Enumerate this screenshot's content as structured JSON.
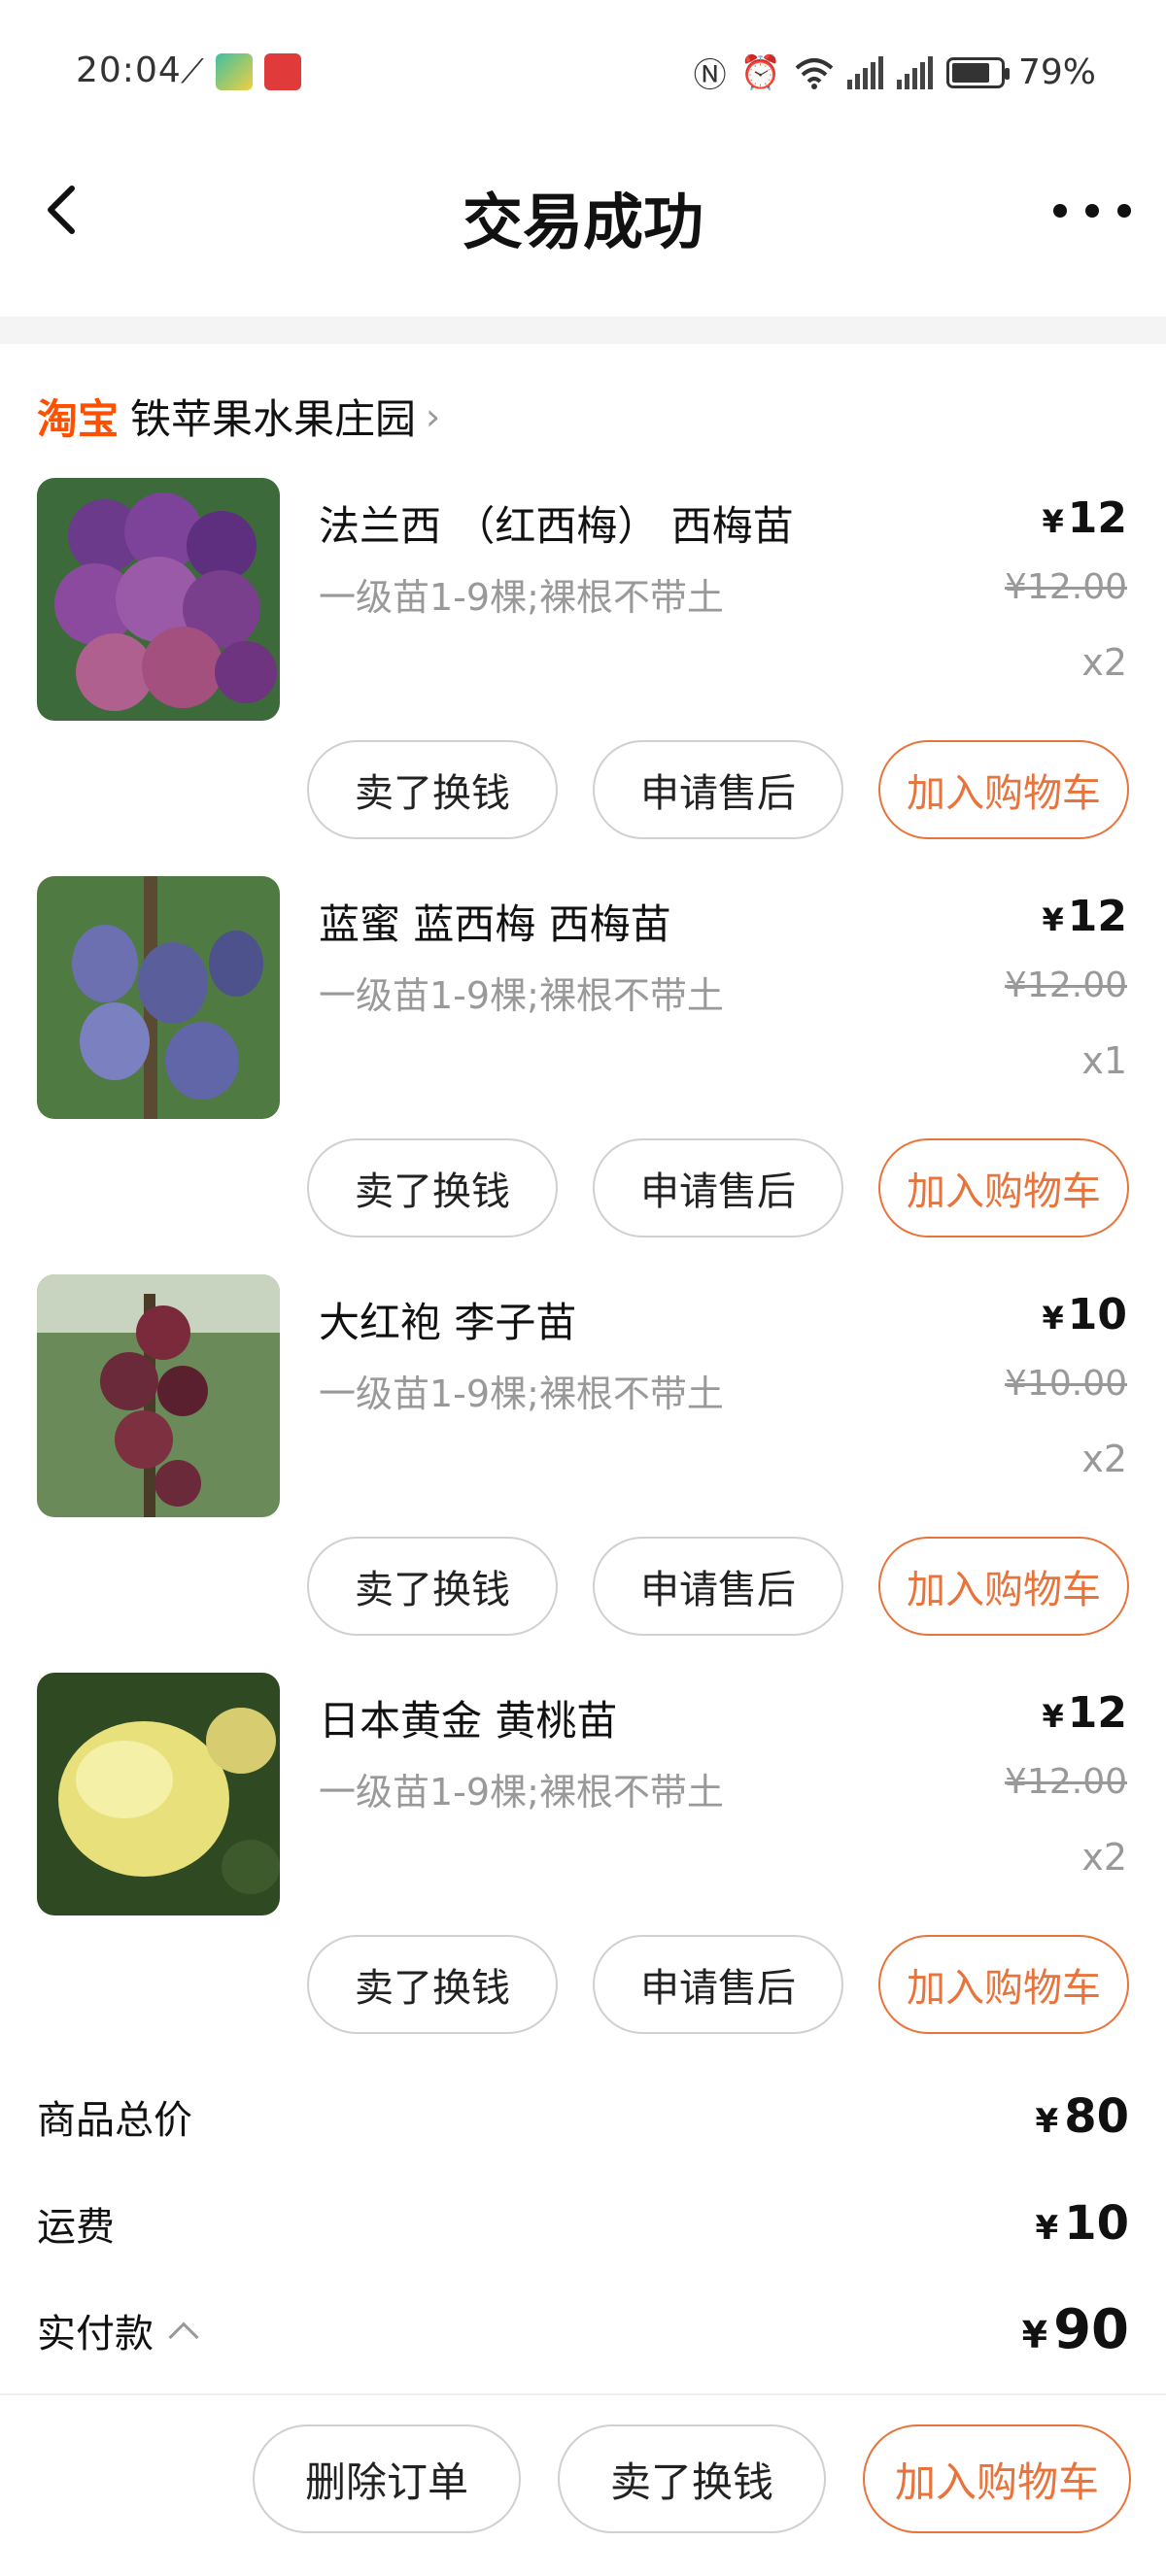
{
  "status_bar": {
    "time": "20:04",
    "battery": "79%",
    "battery_level": 0.79,
    "icons": [
      "link-icon",
      "app-icon-green",
      "app-icon-red",
      "nfc-icon",
      "alarm-icon",
      "wifi-icon",
      "signal-4g-icon",
      "signal-5g-icon"
    ]
  },
  "header": {
    "title": "交易成功"
  },
  "shop": {
    "brand": "淘宝",
    "name": "铁苹果水果庄园",
    "chevron": "›"
  },
  "items": [
    {
      "title": "法兰西 （红西梅） 西梅苗",
      "spec": "一级苗1-9棵;裸根不带土",
      "price": "12",
      "original_price": "¥12.00",
      "qty": "x2",
      "thumb_color": "#7a3f8c",
      "btn_sell": "卖了换钱",
      "btn_after_sale": "申请售后",
      "btn_add_cart": "加入购物车"
    },
    {
      "title": "蓝蜜 蓝西梅 西梅苗",
      "spec": "一级苗1-9棵;裸根不带土",
      "price": "12",
      "original_price": "¥12.00",
      "qty": "x1",
      "thumb_color": "#5a5f9c",
      "btn_sell": "卖了换钱",
      "btn_after_sale": "申请售后",
      "btn_add_cart": "加入购物车"
    },
    {
      "title": "大红袍 李子苗",
      "spec": "一级苗1-9棵;裸根不带土",
      "price": "10",
      "original_price": "¥10.00",
      "qty": "x2",
      "thumb_color": "#6b2a3a",
      "btn_sell": "卖了换钱",
      "btn_after_sale": "申请售后",
      "btn_add_cart": "加入购物车"
    },
    {
      "title": "日本黄金 黄桃苗",
      "spec": "一级苗1-9棵;裸根不带土",
      "price": "12",
      "original_price": "¥12.00",
      "qty": "x2",
      "thumb_color": "#e8e07a",
      "btn_sell": "卖了换钱",
      "btn_after_sale": "申请售后",
      "btn_add_cart": "加入购物车"
    }
  ],
  "summary": {
    "currency": "¥",
    "goods_total_label": "商品总价",
    "goods_total": "80",
    "shipping_label": "运费",
    "shipping": "10",
    "paid_label": "实付款",
    "paid": "90"
  },
  "bottom_bar": {
    "delete_order": "删除订单",
    "sell": "卖了换钱",
    "add_cart": "加入购物车"
  },
  "colors": {
    "accent": "#ff5000",
    "button_orange": "#e8743c",
    "muted_text": "#999999"
  }
}
